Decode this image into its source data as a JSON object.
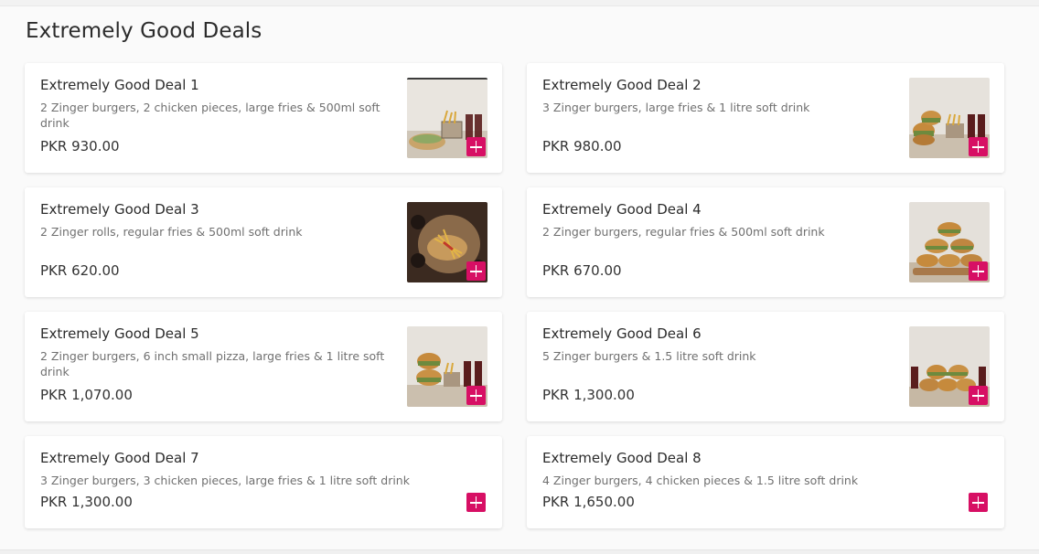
{
  "section": {
    "title": "Extremely Good Deals"
  },
  "deals": [
    {
      "title": "Extremely Good Deal 1",
      "description": "2 Zinger burgers, 2 chicken pieces, large fries & 500ml soft drink",
      "price": "PKR 930.00",
      "image": "rolls-fries-drinks"
    },
    {
      "title": "Extremely Good Deal 2",
      "description": "3 Zinger burgers, large fries & 1 litre soft drink",
      "price": "PKR 980.00",
      "image": "burgers-fries-drinks"
    },
    {
      "title": "Extremely Good Deal 3",
      "description": "2 Zinger rolls, regular fries & 500ml soft drink",
      "price": "PKR 620.00",
      "image": "rolls-fries-topdown"
    },
    {
      "title": "Extremely Good Deal 4",
      "description": "2 Zinger burgers, regular fries & 500ml soft drink",
      "price": "PKR 670.00",
      "image": "burger-stack"
    },
    {
      "title": "Extremely Good Deal 5",
      "description": "2 Zinger burgers, 6 inch small pizza, large fries & 1 litre soft drink",
      "price": "PKR 1,070.00",
      "image": "burgers-fries-drinks"
    },
    {
      "title": "Extremely Good Deal 6",
      "description": "5 Zinger burgers & 1.5 litre soft drink",
      "price": "PKR 1,300.00",
      "image": "burgers-drinks"
    },
    {
      "title": "Extremely Good Deal 7",
      "description": "3 Zinger burgers, 3 chicken pieces, large fries & 1 litre soft drink",
      "price": "PKR 1,300.00",
      "image": null
    },
    {
      "title": "Extremely Good Deal 8",
      "description": "4 Zinger burgers, 4 chicken pieces & 1.5 litre soft drink",
      "price": "PKR 1,650.00",
      "image": null
    }
  ],
  "add_button": {
    "icon": "plus-icon",
    "color": "#d70f64"
  },
  "colors": {
    "accent": "#d70f64",
    "title_text": "#2b2b2b",
    "description_text": "#707070",
    "card_background": "#ffffff",
    "page_background": "#fafafa"
  }
}
